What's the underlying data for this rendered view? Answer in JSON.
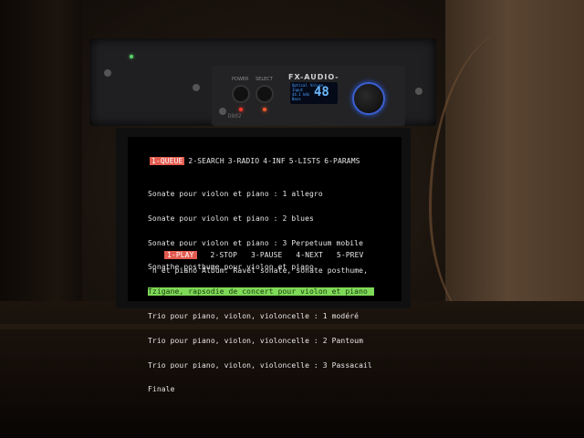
{
  "amp": {
    "brand": "FX-AUDIO-",
    "power_label": "POWER",
    "select_label": "SELECT",
    "model": "D802",
    "display_line1": "Optical",
    "display_line2": "Input",
    "display_line3": "Volume",
    "display_line4": "44.1 kHz",
    "display_line5": "Bass",
    "volume": "48",
    "accent_color": "#2a5ae0"
  },
  "menu": {
    "items": [
      "1-QUEUE",
      "2-SEARCH",
      "3-RADIO",
      "4-INF",
      "5-LISTS",
      "6-PARAMS"
    ],
    "active_index": 0
  },
  "queue": {
    "rows": [
      "Sonate pour violon et piano : 1 allegro",
      "Sonate pour violon et piano : 2 blues",
      "Sonate pour violon et piano : 3 Perpetuum mobile",
      "Sonathe posthume pour violon et piano",
      "Tzigane, rapsodie de concert pour violon et piano",
      "Trio pour piano, violon, violoncelle : 1 modéré",
      "Trio pour piano, violon, violoncelle : 2 Pantoum",
      "Trio pour piano, violon, violoncelle : 3 Passacail",
      "Finale"
    ],
    "selected_index": 4,
    "selected_color": "#7ed957"
  },
  "controls": {
    "items": [
      "1-PLAY",
      "2-STOP",
      "3-PAUSE",
      "4-NEXT",
      "5-PREV"
    ],
    "active_index": 0,
    "active_color": "#e35b4f"
  },
  "status": {
    "text": "n et piano Album: Ravel sonate, sonate posthume, t"
  }
}
